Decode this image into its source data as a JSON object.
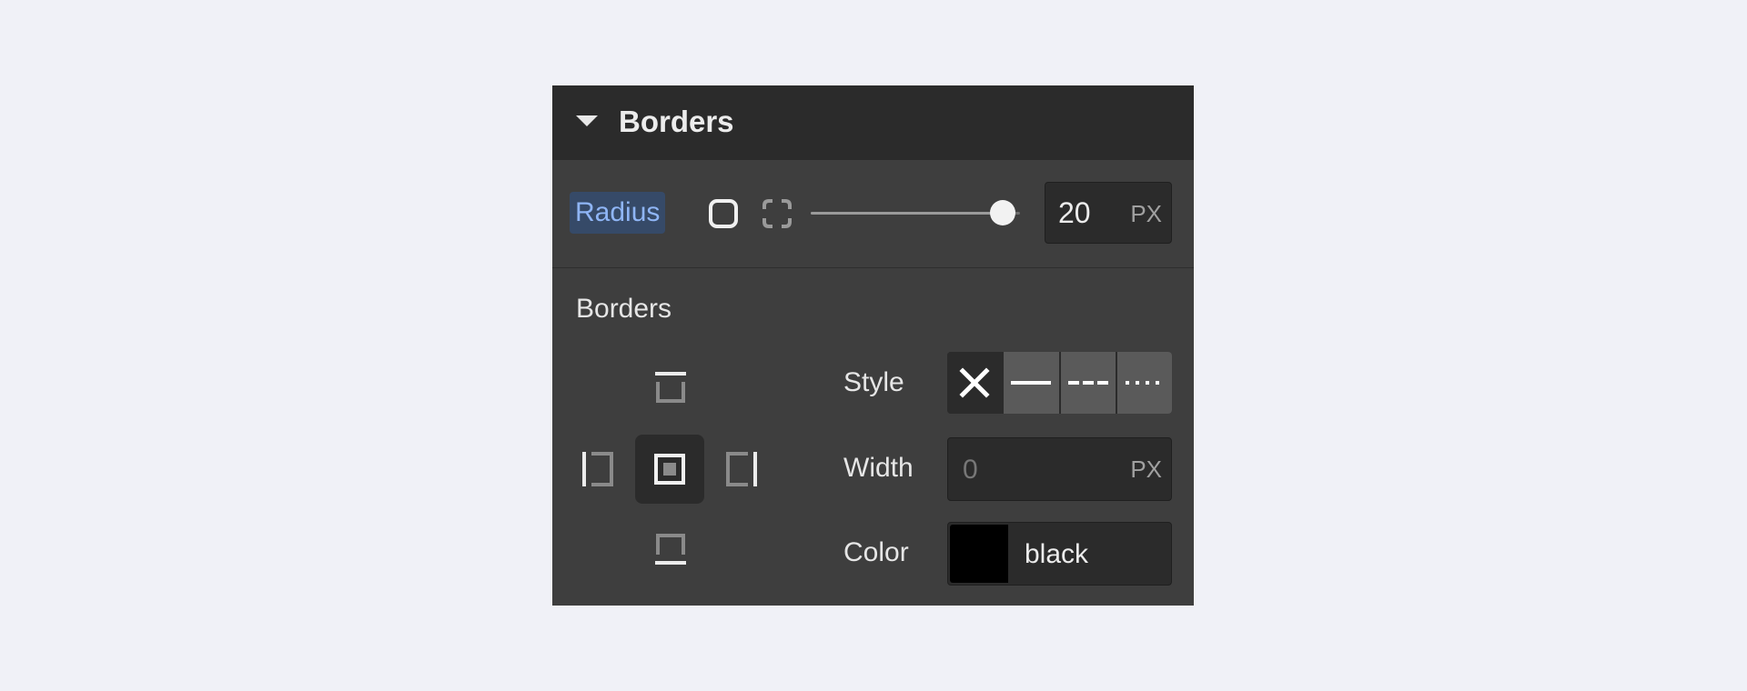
{
  "panel": {
    "title": "Borders",
    "colors": {
      "page_bg": "#f0f1f7",
      "panel_bg": "#3e3e3e",
      "header_bg": "#2b2b2b",
      "accent_label_bg": "#364a68",
      "accent_label_text": "#8fb5f5"
    }
  },
  "radius": {
    "label": "Radius",
    "mode_icons": [
      "all-corners-icon",
      "individual-corners-icon"
    ],
    "slider_value_fraction": 0.85,
    "value": "20",
    "unit": "PX"
  },
  "borders": {
    "label": "Borders",
    "sides": [
      "top",
      "left",
      "all",
      "right",
      "bottom"
    ],
    "selected_side": "all",
    "style": {
      "label": "Style",
      "options": [
        "none",
        "solid",
        "dashed",
        "dotted"
      ],
      "selected": "none"
    },
    "width": {
      "label": "Width",
      "placeholder": "0",
      "unit": "PX"
    },
    "color": {
      "label": "Color",
      "swatch": "#000000",
      "value": "black"
    }
  }
}
